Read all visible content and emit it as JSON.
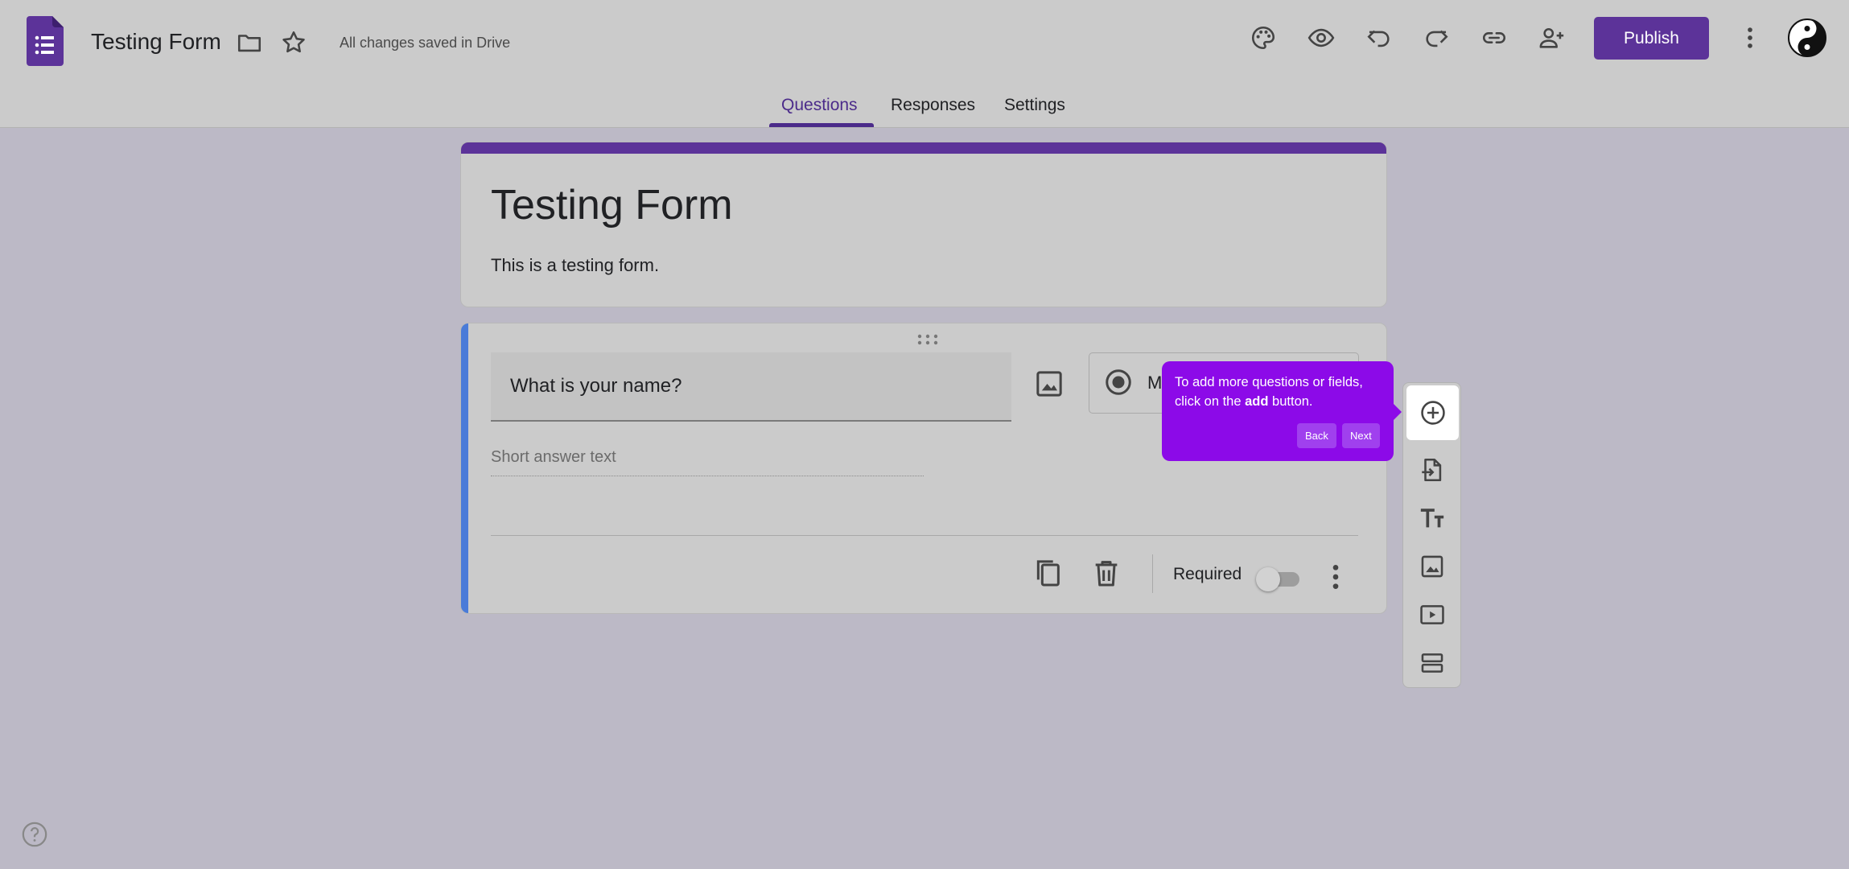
{
  "header": {
    "doc_title": "Testing Form",
    "save_status": "All changes saved in Drive",
    "publish_label": "Publish",
    "icons": [
      "folder-icon",
      "star-icon",
      "palette-icon",
      "eye-icon",
      "undo-icon",
      "redo-icon",
      "link-icon",
      "add-person-icon",
      "more-vert-icon"
    ]
  },
  "tabs": [
    {
      "label": "Questions",
      "active": true
    },
    {
      "label": "Responses",
      "active": false
    },
    {
      "label": "Settings",
      "active": false
    }
  ],
  "form": {
    "title": "Testing Form",
    "description": "This is a testing form."
  },
  "question": {
    "text": "What is your name?",
    "type_label": "M",
    "answer_placeholder": "Short answer text",
    "required_label": "Required",
    "required": false
  },
  "tooltip": {
    "text_before": "To add more questions or fields, click on the ",
    "text_bold": "add",
    "text_after": " button.",
    "back_label": "Back",
    "next_label": "Next"
  },
  "colors": {
    "accent": "#5c3399",
    "tooltip": "#8c0ae8",
    "question_accent": "#4a7bd8"
  }
}
